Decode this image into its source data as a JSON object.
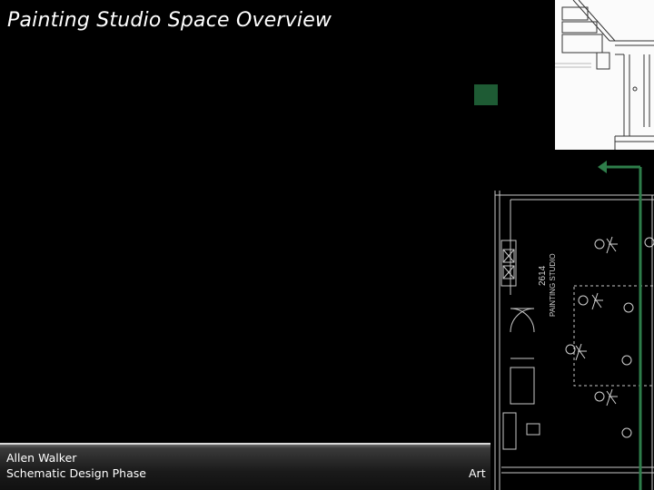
{
  "slide": {
    "title": "Painting Studio Space Overview"
  },
  "footer": {
    "author": "Allen Walker",
    "phase": "Schematic Design Phase",
    "right_text": "Art"
  },
  "plan": {
    "room_number": "2614",
    "room_name": "PAINTING STUDIO"
  },
  "colors": {
    "background": "#000000",
    "accent": "#1e5b34",
    "arrow": "#2e7d4a",
    "plan_lines": "#c8c8c8"
  }
}
